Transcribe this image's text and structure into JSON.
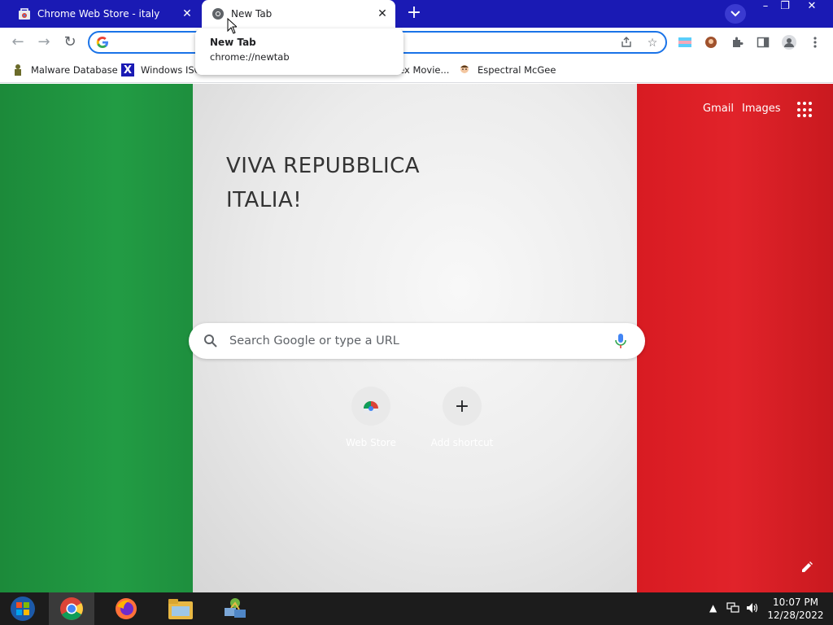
{
  "tabs": [
    {
      "title": "Chrome Web Store - italy",
      "icon": "chrome-web-store-icon"
    },
    {
      "title": "New Tab",
      "icon": "chrome-icon"
    }
  ],
  "tooltip": {
    "title": "New Tab",
    "url": "chrome://newtab"
  },
  "omnibox": {
    "value": "",
    "placeholder": ""
  },
  "bookmarks": [
    {
      "label": "Malware Database",
      "icon": "malware-icon"
    },
    {
      "label": "Windows ISO",
      "icon": "x-icon"
    },
    {
      "label": "Plex Movie...",
      "icon": "plex-icon"
    },
    {
      "label": "Espectral McGee",
      "icon": "person-icon"
    }
  ],
  "ntp": {
    "links": {
      "gmail": "Gmail",
      "images": "Images"
    },
    "doodle_line1": "VIVA REPUBBLICA",
    "doodle_line2": "ITALIA!",
    "search_placeholder": "Search Google or type a URL",
    "shortcuts": [
      {
        "label": "Web Store",
        "icon": "chrome-web-store-icon"
      },
      {
        "label": "Add shortcut",
        "icon": "plus-icon"
      }
    ]
  },
  "taskbar": {
    "time": "10:07 PM",
    "date": "12/28/2022"
  },
  "colors": {
    "tabstrip": "#1a1ab4",
    "flag_green": "#229c44",
    "flag_white": "#ececec",
    "flag_red": "#e1232a",
    "accent": "#1a73e8"
  }
}
